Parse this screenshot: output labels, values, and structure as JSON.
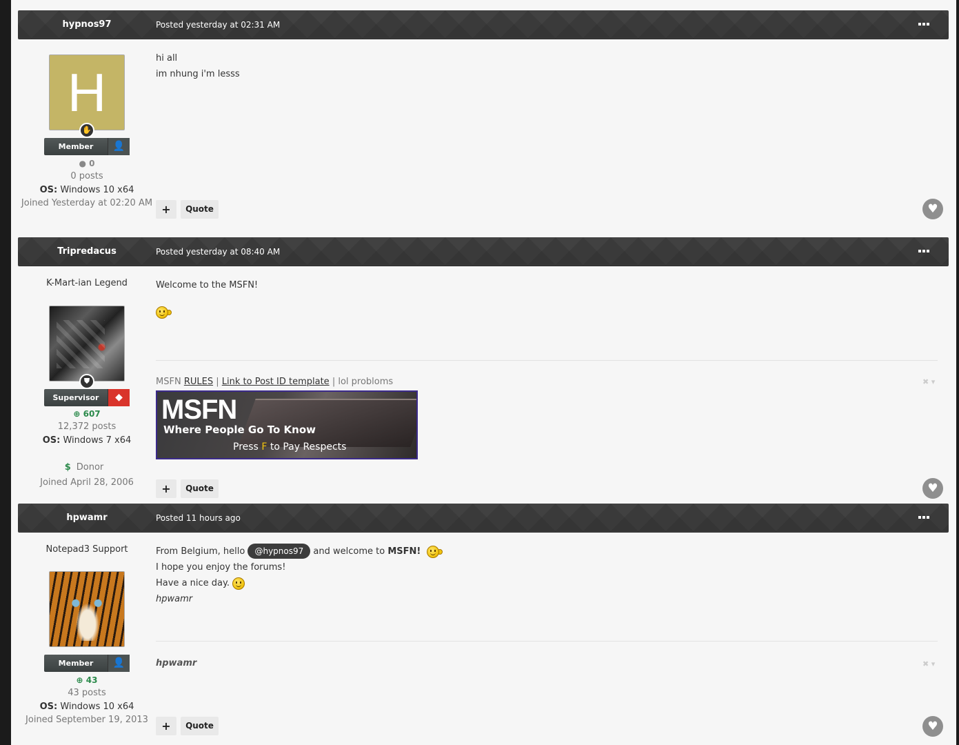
{
  "posts": [
    {
      "author": "hypnos97",
      "date": "Posted yesterday at 02:31 AM",
      "user_title": "",
      "avatar_letter": "H",
      "group": "Member",
      "reputation": "0",
      "posts_count": "0 posts",
      "os_label": "OS:",
      "os_value": "Windows 10 x64",
      "joined": "Joined Yesterday at 02:20 AM",
      "body": [
        "hi all",
        "im nhung i'm lesss"
      ],
      "plus_label": "+",
      "quote_label": "Quote"
    },
    {
      "author": "Tripredacus",
      "date": "Posted yesterday at 08:40 AM",
      "user_title": "K-Mart-ian Legend",
      "group": "Supervisor",
      "reputation": "607",
      "posts_count": "12,372 posts",
      "os_label": "OS:",
      "os_value": "Windows 7 x64",
      "donor_icon": "$",
      "donor": "Donor",
      "joined": "Joined April 28, 2006",
      "body": [
        "Welcome to the MSFN!"
      ],
      "signature": {
        "prefix": "MSFN",
        "link1": "RULES",
        "sep1": "|",
        "link2": "Link to Post ID template",
        "sep2": "|",
        "suffix": "lol probloms",
        "banner_title": "MSFN",
        "banner_subtitle": "Where People Go To Know",
        "banner_press": "Press",
        "banner_key": "F",
        "banner_action": "to Pay Respects"
      },
      "plus_label": "+",
      "quote_label": "Quote"
    },
    {
      "author": "hpwamr",
      "date": "Posted 11 hours ago",
      "user_title": "Notepad3 Support",
      "group": "Member",
      "reputation": "43",
      "posts_count": "43 posts",
      "os_label": "OS:",
      "os_value": "Windows 10 x64",
      "joined": "Joined September 19, 2013",
      "body_line1_pre": "From Belgium, hello",
      "mention": "@hypnos97",
      "body_line1_mid": "and welcome to",
      "body_line1_bold": "MSFN!",
      "body_line2": "I hope you enjoy the forums!",
      "body_line3": "Have a nice day.",
      "body_line4": "hpwamr",
      "signature_text": "hpwamr",
      "plus_label": "+",
      "quote_label": "Quote"
    }
  ],
  "icons": {
    "menu": "ellipsis-icon",
    "like": "heart-icon",
    "rank": "hand-icon",
    "shield": "shield-icon",
    "member_group": "person-icon",
    "supervisor_group": "diamond-icon",
    "rep_positive": "plus-circle-icon",
    "rep_neutral": "dot-icon"
  },
  "colors": {
    "header_bg": "#3a3a3a",
    "page_bg": "#f6f6f6",
    "rep_positive": "#2b8a4b",
    "avatar_letter_bg": "#c4b566"
  }
}
